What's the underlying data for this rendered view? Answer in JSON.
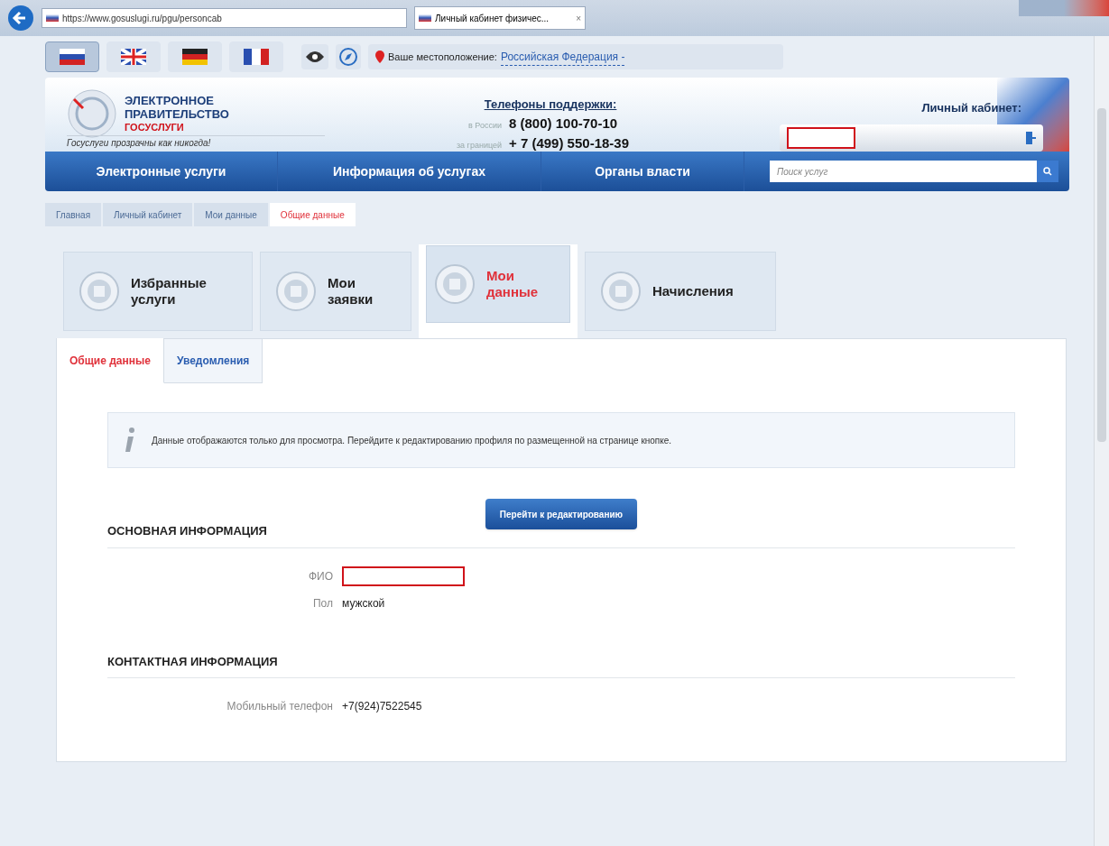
{
  "browser": {
    "url": "https://www.gosuslugi.ru/pgu/personcab",
    "tab_title": "Личный кабинет физичес...",
    "tab_close": "×"
  },
  "languages": [
    {
      "kind": "ru",
      "selected": true
    },
    {
      "kind": "gb",
      "selected": false
    },
    {
      "kind": "de",
      "selected": false
    },
    {
      "kind": "fr",
      "selected": false
    }
  ],
  "location": {
    "label": "Ваше местоположение:",
    "value": "Российская Федерация -"
  },
  "header": {
    "logo_lines": [
      "ЭЛЕКТРОННОЕ",
      "ПРАВИТЕЛЬСТВО",
      "ГОСУСЛУГИ"
    ],
    "slogan": "Госуслуги прозрачны как никогда!",
    "support_title": "Телефоны поддержки:",
    "phones": [
      {
        "label": "в России",
        "number": "8 (800) 100-70-10"
      },
      {
        "label": "за границей",
        "number": "+ 7 (499) 550-18-39"
      }
    ],
    "cabinet_title": "Личный кабинет:"
  },
  "nav": {
    "items": [
      "Электронные услуги",
      "Информация об услугах",
      "Органы власти"
    ],
    "search_placeholder": "Поиск услуг"
  },
  "breadcrumbs": [
    {
      "label": "Главная",
      "selected": false
    },
    {
      "label": "Личный кабинет",
      "selected": false
    },
    {
      "label": "Мои данные",
      "selected": false
    },
    {
      "label": "Общие данные",
      "selected": true
    }
  ],
  "sections": [
    {
      "label": "Избранные услуги",
      "selected": false
    },
    {
      "label": "Мои заявки",
      "selected": false
    },
    {
      "label": "Мои данные",
      "selected": true
    },
    {
      "label": "Начисления",
      "selected": false
    }
  ],
  "subtabs": [
    {
      "label": "Общие данные",
      "selected": true
    },
    {
      "label": "Уведомления",
      "selected": false
    }
  ],
  "info": "Данные отображаются только для просмотра. Перейдите к редактированию профиля по размещенной на странице кнопке.",
  "edit_button": "Перейти к редактированию",
  "groups": [
    {
      "title": "ОСНОВНАЯ ИНФОРМАЦИЯ",
      "fields": [
        {
          "label": "ФИО",
          "redacted": true
        },
        {
          "label": "Пол",
          "value": "мужской",
          "redacted": false
        }
      ]
    },
    {
      "title": "КОНТАКТНАЯ ИНФОРМАЦИЯ",
      "fields": [
        {
          "label": "Мобильный телефон",
          "value": "+7(924)7522545",
          "redacted": false
        }
      ]
    }
  ]
}
